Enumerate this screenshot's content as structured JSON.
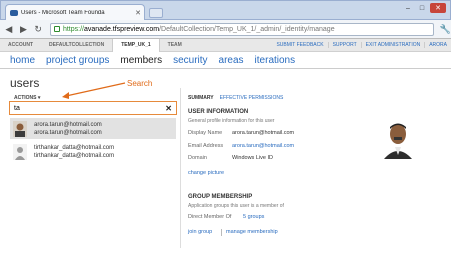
{
  "browser": {
    "tab_title": "Users - Microsoft Team Founda",
    "url_scheme": "https://",
    "url_host": "avanade.tfspreview.com",
    "url_path": "/DefaultCollection/Temp_UK_1/_admin/_identity/manage"
  },
  "tfs_header": {
    "crumbs": [
      "ACCOUNT",
      "DEFAULTCOLLECTION",
      "TEMP_UK_1",
      "TEAM"
    ],
    "right_links": [
      "SUBMIT FEEDBACK",
      "SUPPORT",
      "EXIT ADMINISTRATION",
      "ARORA"
    ]
  },
  "hub_nav": [
    "home",
    "project groups",
    "members",
    "security",
    "areas",
    "iterations"
  ],
  "left": {
    "title": "users",
    "actions_label": "ACTIONS",
    "search_value": "ta",
    "callout": "Search",
    "results": [
      {
        "line1": "arora.tarun@hotmail.com",
        "line2": "arora.tarun@hotmail.com"
      },
      {
        "line1": "tirthankar_datta@hotmail.com",
        "line2": "tirthankar_datta@hotmail.com"
      }
    ]
  },
  "right": {
    "pivot": [
      "SUMMARY",
      "EFFECTIVE PERMISSIONS"
    ],
    "user_info_heading": "USER INFORMATION",
    "user_info_sub": "General profile information for this user",
    "display_name_label": "Display Name",
    "display_name": "arora.tarun@hotmail.com",
    "email_label": "Email Address",
    "email": "arora.tarun@hotmail.com",
    "domain_label": "Domain",
    "domain": "Windows Live ID",
    "change_picture": "change picture",
    "group_heading": "GROUP MEMBERSHIP",
    "group_sub": "Application groups this user is a member of",
    "direct_member_label": "Direct Member Of",
    "direct_member_value": "5 groups",
    "join_group": "join group",
    "manage_membership": "manage membership"
  }
}
